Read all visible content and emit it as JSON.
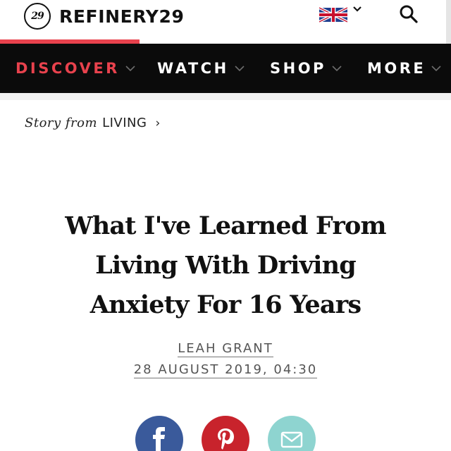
{
  "header": {
    "logo_mark": "29",
    "logo_text": "REFINERY29",
    "region_flag": "uk-flag-icon",
    "icons": [
      "chevron-down-icon",
      "search-icon"
    ],
    "reading_progress": 0.31,
    "colors": {
      "accent": "#e8424d",
      "nav_bg": "#0b0b0b"
    }
  },
  "nav": {
    "items": [
      {
        "label": "DISCOVER",
        "active": true
      },
      {
        "label": "WATCH",
        "active": false
      },
      {
        "label": "SHOP",
        "active": false
      },
      {
        "label": "MORE",
        "active": false
      }
    ]
  },
  "story": {
    "prefix": "Story from",
    "category": "LIVING",
    "arrow": "›"
  },
  "article": {
    "headline_line1": "What I've Learned From",
    "headline_line2": "Living With Driving",
    "headline_line3": "Anxiety For 16 Years",
    "author": "LEAH GRANT",
    "date": "28 AUGUST 2019, 04:30"
  },
  "share": {
    "buttons": [
      {
        "icon": "facebook-icon",
        "color": "#3a5a9b"
      },
      {
        "icon": "pinterest-icon",
        "color": "#c8232c"
      },
      {
        "icon": "email-icon",
        "color": "#8ed4d0"
      }
    ]
  }
}
